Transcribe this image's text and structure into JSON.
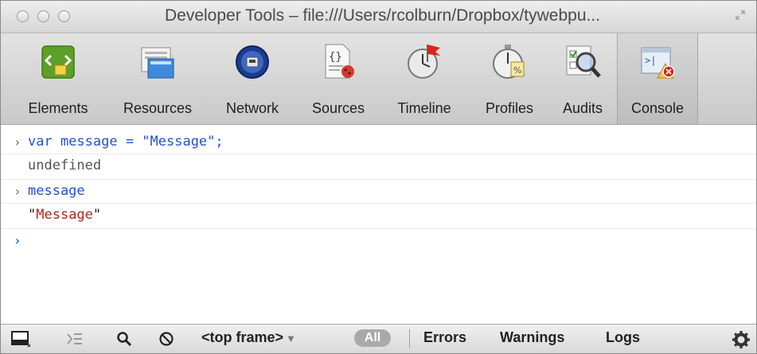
{
  "window": {
    "title": "Developer Tools – file:///Users/rcolburn/Dropbox/tywebpu..."
  },
  "toolbar": {
    "tabs": [
      {
        "label": "Elements",
        "icon": "elements-icon"
      },
      {
        "label": "Resources",
        "icon": "resources-icon"
      },
      {
        "label": "Network",
        "icon": "network-icon"
      },
      {
        "label": "Sources",
        "icon": "sources-icon"
      },
      {
        "label": "Timeline",
        "icon": "timeline-icon"
      },
      {
        "label": "Profiles",
        "icon": "profiles-icon"
      },
      {
        "label": "Audits",
        "icon": "audits-icon"
      },
      {
        "label": "Console",
        "icon": "console-icon",
        "active": true
      }
    ]
  },
  "console": {
    "entries": [
      {
        "type": "input",
        "text": "var message = \"Message\";"
      },
      {
        "type": "output",
        "text": "undefined"
      },
      {
        "type": "input",
        "text": "message"
      },
      {
        "type": "output-string",
        "quote_open": "\"",
        "value": "Message",
        "quote_close": "\""
      }
    ],
    "prompt": "›"
  },
  "statusbar": {
    "frame_select": "<top frame>",
    "filters": {
      "all": "All",
      "errors": "Errors",
      "warnings": "Warnings",
      "logs": "Logs"
    },
    "icons": [
      "dock-icon",
      "console-drawer-icon",
      "search-icon",
      "clear-icon",
      "gear-icon"
    ]
  },
  "colors": {
    "input_text": "#2550d0",
    "string_value": "#b0261c",
    "prompt_active": "#2d6fd6"
  }
}
